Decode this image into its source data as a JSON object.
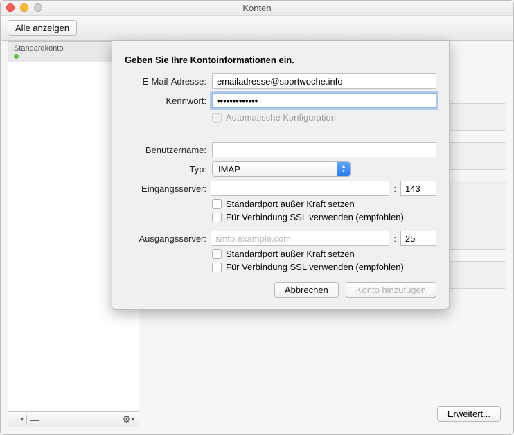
{
  "window": {
    "title": "Konten"
  },
  "toolbar": {
    "show_all": "Alle anzeigen"
  },
  "sidebar": {
    "header": "Standardkonto",
    "footer": {
      "add": "+",
      "remove": "—",
      "gear": "⚙"
    }
  },
  "main": {
    "erweitert": "Erweitert..."
  },
  "sheet": {
    "title": "Geben Sie Ihre Kontoinformationen ein.",
    "email_label": "E-Mail-Adresse:",
    "email_value": "emailadresse@sportwoche.info",
    "password_label": "Kennwort:",
    "password_value": "•••••••••••••",
    "auto_config": "Automatische Konfiguration",
    "username_label": "Benutzername:",
    "username_value": "",
    "type_label": "Typ:",
    "type_value": "IMAP",
    "in_server_label": "Eingangsserver:",
    "in_server_value": "",
    "in_port": "143",
    "override_port": "Standardport außer Kraft setzen",
    "ssl_rec": "Für Verbindung SSL verwenden (empfohlen)",
    "out_server_label": "Ausgangsserver:",
    "out_server_placeholder": "smtp.example.com",
    "out_server_value": "",
    "out_port": "25",
    "cancel": "Abbrechen",
    "add": "Konto hinzufügen"
  }
}
